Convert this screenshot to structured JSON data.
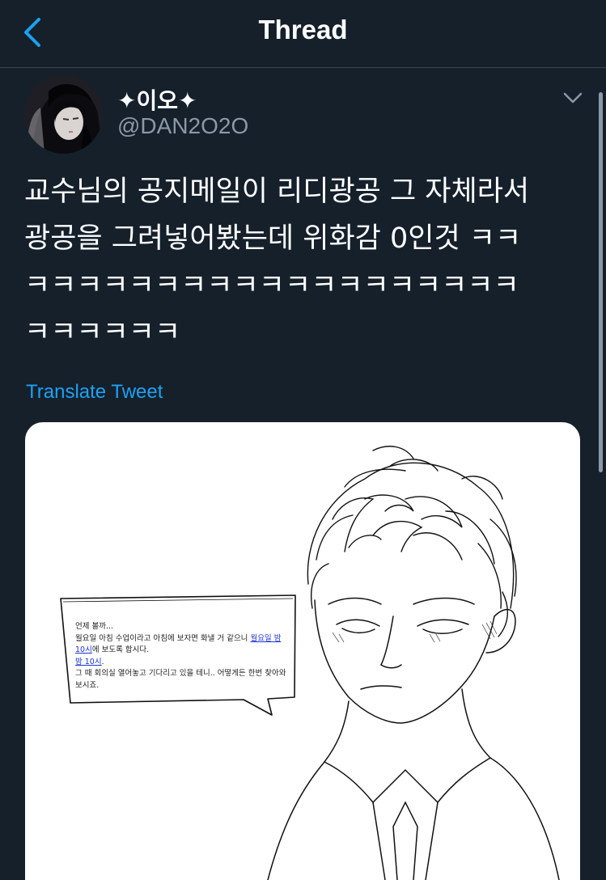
{
  "header": {
    "title": "Thread",
    "back_icon": "chevron-left-icon"
  },
  "colors": {
    "background": "#15202b",
    "accent": "#1da1f2",
    "secondary_text": "#8b98a5",
    "divider": "#38444d"
  },
  "tweet": {
    "display_name": "✦이오✦",
    "handle": "@DAN2O2O",
    "text": "교수님의 공지메일이 리디광공 그 자체라서\n광공을 그려넣어봤는데 위화감 0인것 ㅋㅋ\nㅋㅋㅋㅋㅋㅋㅋㅋㅋㅋㅋㅋㅋㅋㅋㅋㅋㅋㅋ\nㅋㅋㅋㅋㅋㅋ",
    "translate_label": "Translate Tweet",
    "menu_icon": "chevron-down-icon"
  },
  "media": {
    "speech_lines": {
      "line1": "언제 볼까...",
      "line2_prefix": "월요일 아침 수업이라고 아침에 보자면 화낼 거 같으니 ",
      "line2_link": "월요일 밤 10시",
      "line2_suffix": "에 보도록 합시다.",
      "line3_link": "밤 10시",
      "line3_suffix": ".",
      "line4": "그 때 회의실 열어놓고 기다리고 있을 테니.. 어떻게든 한번 찾아와 보시죠."
    }
  }
}
